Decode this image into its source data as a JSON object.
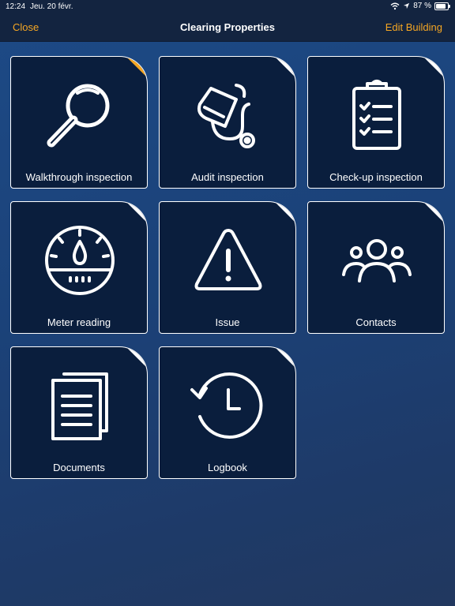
{
  "status_bar": {
    "time": "12:24",
    "date": "Jeu. 20 févr.",
    "battery": "87 %"
  },
  "nav": {
    "close_label": "Close",
    "title": "Clearing Properties",
    "edit_label": "Edit Building"
  },
  "colors": {
    "accent": "#f5a623",
    "tile_bg": "#0a1e3d",
    "bar_bg": "#132440"
  },
  "tiles": [
    {
      "label": "Walkthrough inspection",
      "icon": "magnifier-icon",
      "highlighted": true
    },
    {
      "label": "Audit inspection",
      "icon": "stethoscope-icon",
      "highlighted": false
    },
    {
      "label": "Check-up inspection",
      "icon": "clipboard-checklist-icon",
      "highlighted": false
    },
    {
      "label": "Meter reading",
      "icon": "gauge-icon",
      "highlighted": false
    },
    {
      "label": "Issue",
      "icon": "warning-triangle-icon",
      "highlighted": false
    },
    {
      "label": "Contacts",
      "icon": "people-group-icon",
      "highlighted": false
    },
    {
      "label": "Documents",
      "icon": "documents-icon",
      "highlighted": false
    },
    {
      "label": "Logbook",
      "icon": "history-clock-icon",
      "highlighted": false
    }
  ]
}
